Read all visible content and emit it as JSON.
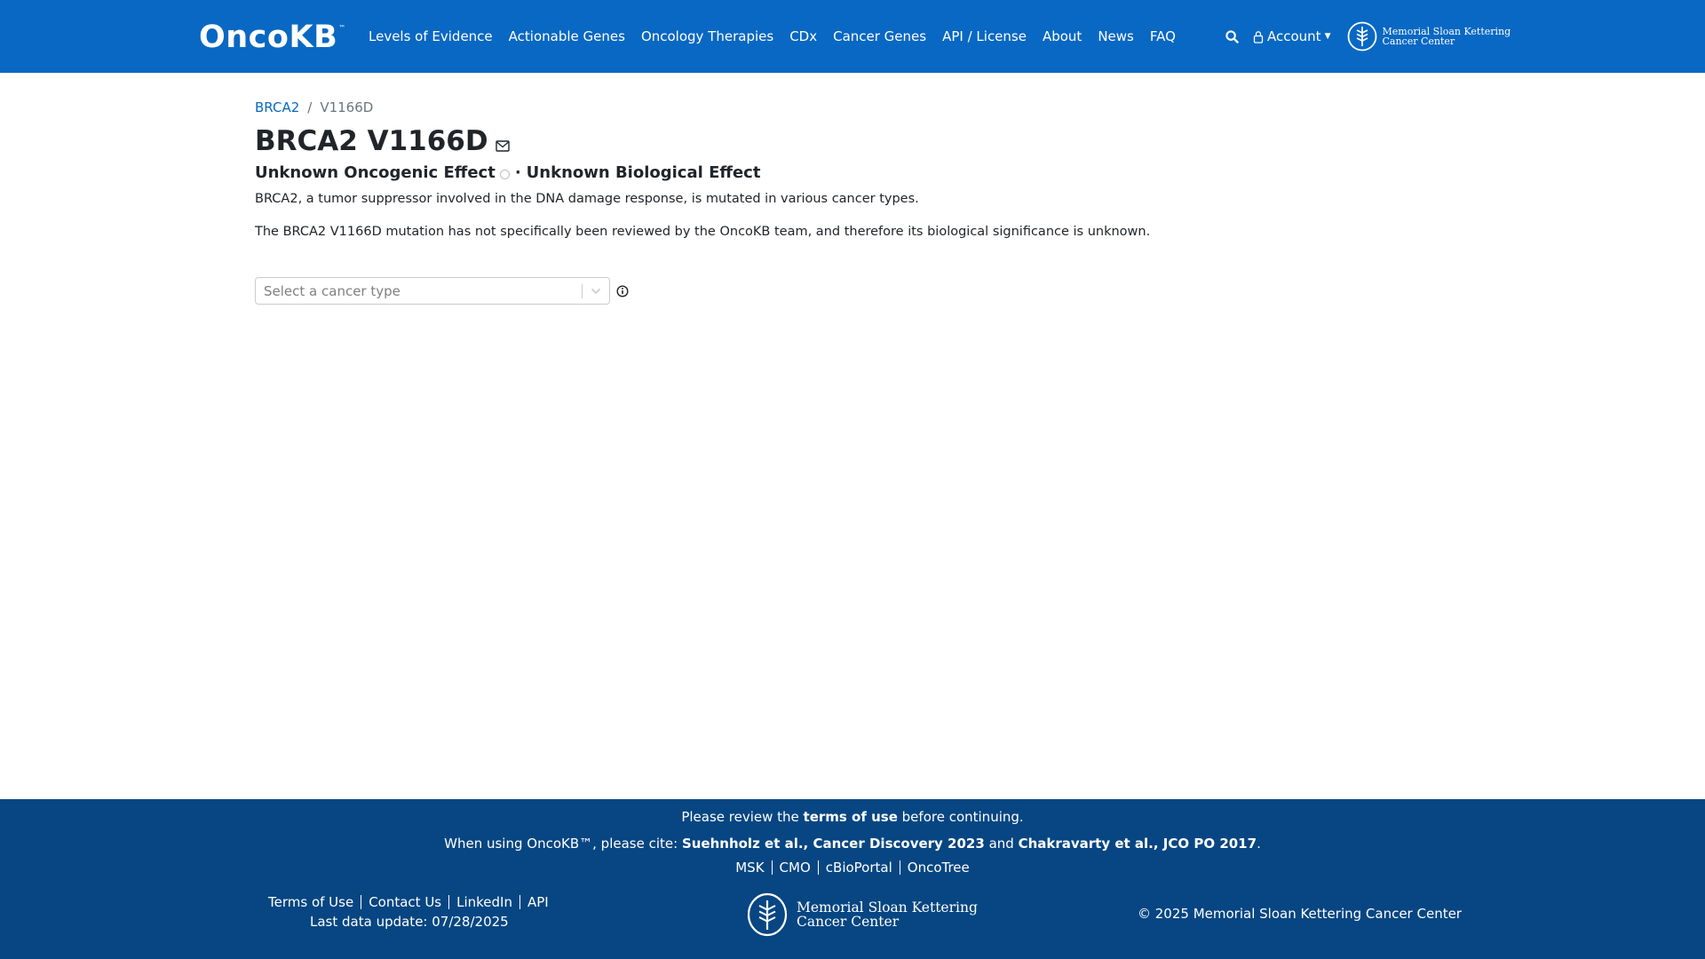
{
  "colors": {
    "navbar": "#0968c3",
    "footer": "#074682",
    "link": "#0968c3",
    "text": "#212529",
    "muted": "#6c757d"
  },
  "navbar": {
    "logo_text": "OncoKB",
    "logo_tm": "™",
    "links": [
      "Levels of Evidence",
      "Actionable Genes",
      "Oncology Therapies",
      "CDx",
      "Cancer Genes",
      "API / License",
      "About",
      "News",
      "FAQ"
    ],
    "account_label": "Account",
    "msk_line1": "Memorial Sloan Kettering",
    "msk_line2": "Cancer Center",
    "icons": {
      "search": "search-icon",
      "account": "user-icon",
      "caret": "caret-down-icon",
      "msk_logo": "msk-logo-icon"
    }
  },
  "breadcrumb": {
    "gene": "BRCA2",
    "separator": "/",
    "current": "V1166D"
  },
  "page": {
    "title": "BRCA2 V1166D",
    "oncogenic_effect": "Unknown Oncogenic Effect",
    "dot": "·",
    "biological_effect": "Unknown Biological Effect",
    "description_1": "BRCA2, a tumor suppressor involved in the DNA damage response, is mutated in various cancer types.",
    "description_2": "The BRCA2 V1166D mutation has not specifically been reviewed by the OncoKB team, and therefore its biological significance is unknown."
  },
  "cancer_type_select": {
    "placeholder": "Select a cancer type"
  },
  "footer": {
    "notice_pre": "Please review the ",
    "notice_link": "terms of use",
    "notice_post": " before continuing.",
    "cite_pre": "When using OncoKB™, please cite: ",
    "cite_1": "Suehnholz et al., Cancer Discovery 2023",
    "cite_and": " and ",
    "cite_2": "Chakravarty et al., JCO PO 2017",
    "cite_end": ".",
    "partner_links": [
      "MSK",
      "CMO",
      "cBioPortal",
      "OncoTree"
    ],
    "bottom_links": [
      "Terms of Use",
      "Contact Us",
      "LinkedIn",
      "API"
    ],
    "last_update": "Last data update: 07/28/2025",
    "msk_line1": "Memorial Sloan Kettering",
    "msk_line2": "Cancer Center",
    "copyright": "© 2025 Memorial Sloan Kettering Cancer Center"
  }
}
